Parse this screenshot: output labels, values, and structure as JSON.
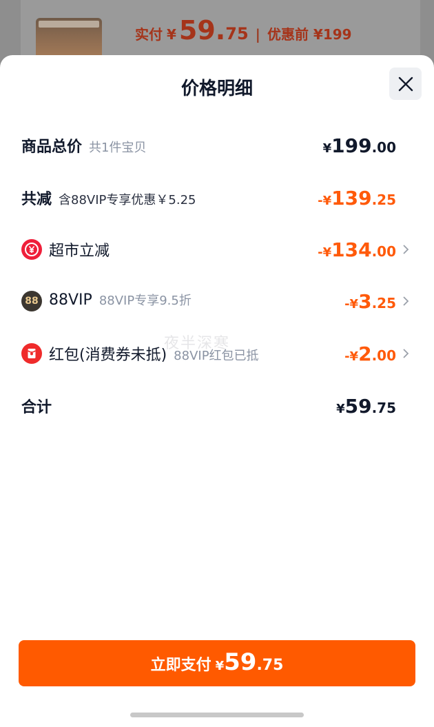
{
  "background_card": {
    "paid_label": "实付",
    "currency": "¥",
    "paid_int": "59.",
    "paid_dec": "75",
    "separator": "|",
    "original_label": "优惠前 ¥199"
  },
  "sheet": {
    "title": "价格明细",
    "close_icon": "close-icon"
  },
  "rows": [
    {
      "title": "商品总价",
      "subtitle": "共1件宝贝",
      "amount_prefix": "¥",
      "amount_int": "199",
      "amount_dec": ".00"
    },
    {
      "title": "共减",
      "subtitle": "含88VIP专享优惠￥5.25",
      "amount_prefix": "-¥",
      "amount_int": "139",
      "amount_dec": ".25"
    },
    {
      "title": "超市立减",
      "icon": "yuan-coin-icon",
      "amount_prefix": "-¥",
      "amount_int": "134",
      "amount_dec": ".00"
    },
    {
      "title": "88VIP",
      "subtitle": "88VIP专享9.5折",
      "icon_text": "88",
      "amount_prefix": "-¥",
      "amount_int": "3",
      "amount_dec": ".25"
    },
    {
      "title": "红包(消费券未抵)",
      "subtitle": "88VIP红包已抵",
      "icon": "red-envelope-icon",
      "amount_prefix": "-¥",
      "amount_int": "2",
      "amount_dec": ".00"
    },
    {
      "title": "合计",
      "amount_prefix": "¥",
      "amount_int": "59",
      "amount_dec": ".75"
    }
  ],
  "watermark": "夜半深寒",
  "pay_button": {
    "label": "立即支付",
    "currency": "¥",
    "amount_int": "59",
    "amount_dec": ".75"
  },
  "colors": {
    "accent": "#ff5a00",
    "discount": "#ff5a0a",
    "text_primary": "#11192b",
    "text_secondary": "#8a93a3"
  }
}
